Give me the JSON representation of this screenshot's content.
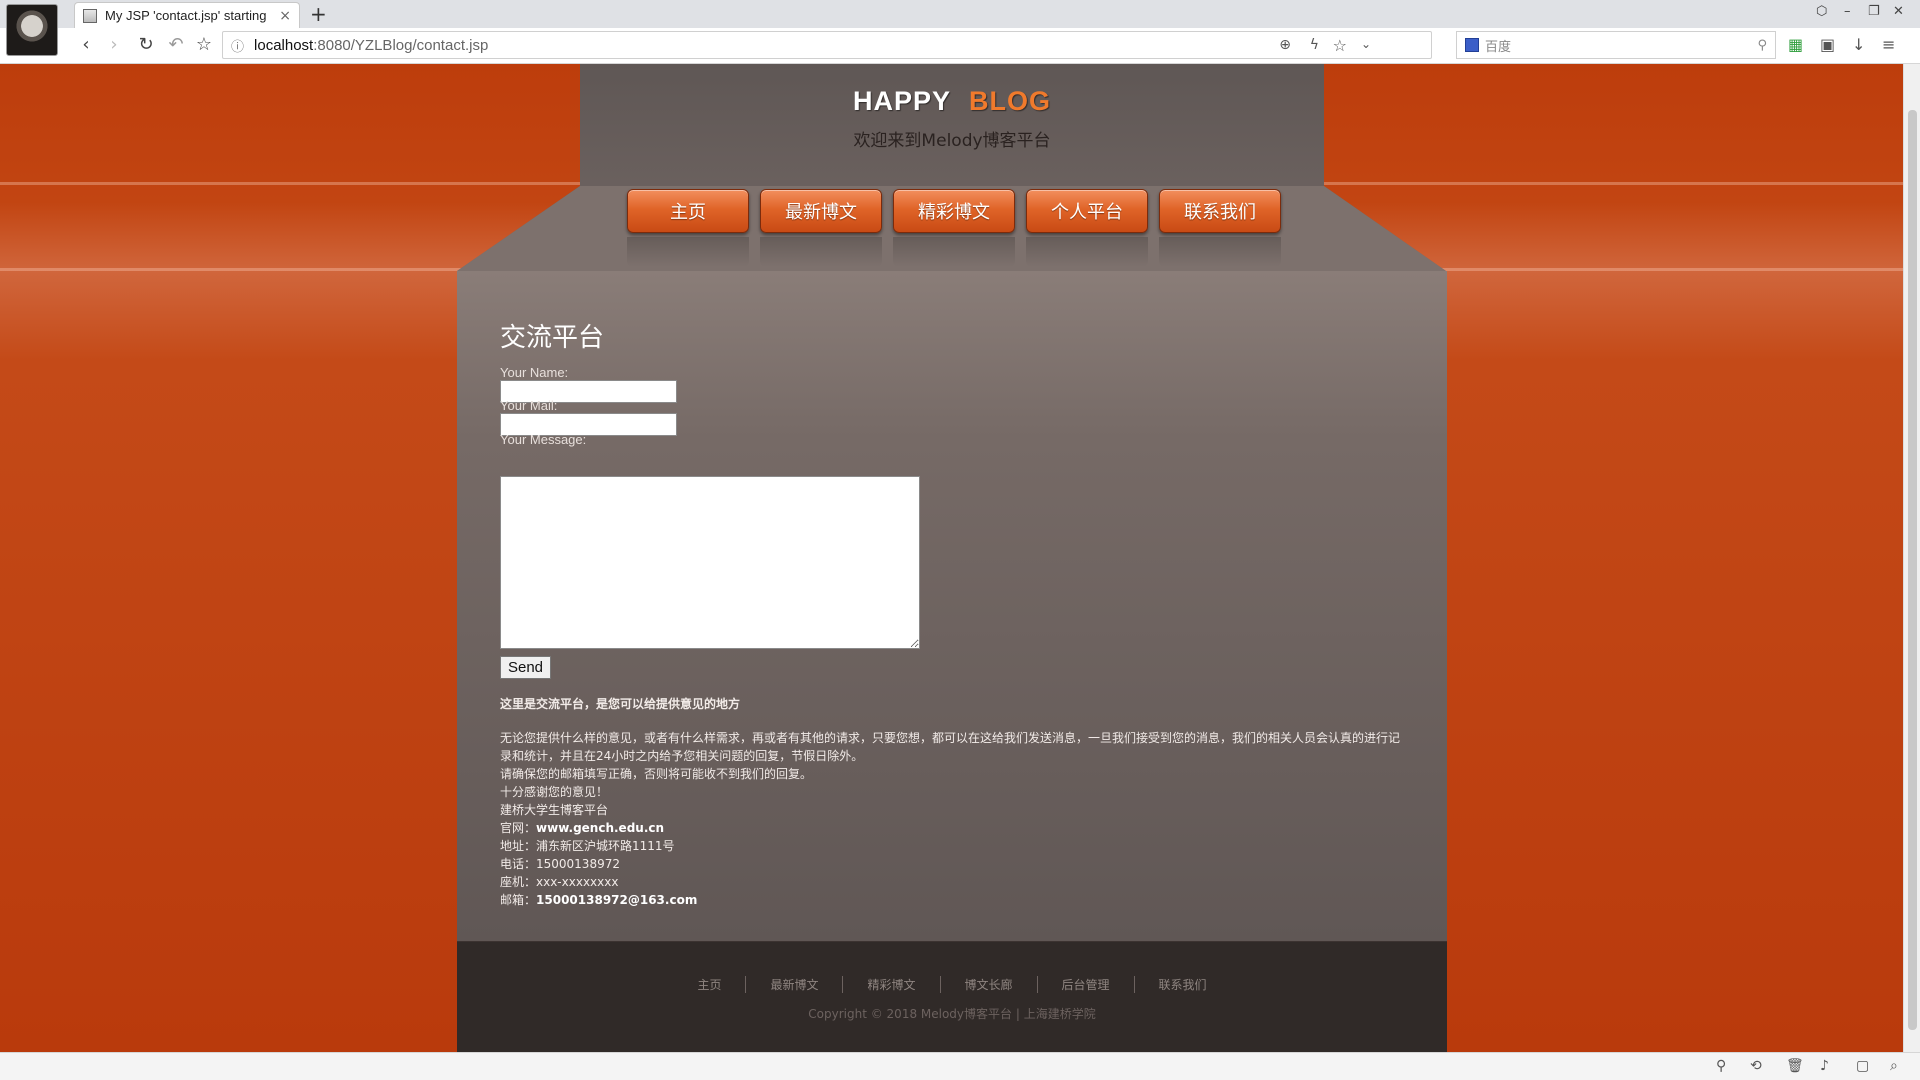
{
  "browser": {
    "tab_title": "My JSP 'contact.jsp' starting",
    "tab_close": "×",
    "new_tab": "+",
    "url_host": "localhost",
    "url_path": ":8080/YZLBlog/contact.jsp",
    "search_placeholder": "百度",
    "window_controls": [
      "–",
      "❐",
      "✕"
    ]
  },
  "site": {
    "logo_part1": "HAPPY",
    "logo_part2": "BLOG",
    "tagline": "欢迎来到Melody博客平台",
    "nav": [
      "主页",
      "最新博文",
      "精彩博文",
      "个人平台",
      "联系我们"
    ]
  },
  "contact": {
    "heading": "交流平台",
    "name_label": "Your Name:",
    "mail_label": "Your Mail:",
    "message_label": "Your Message:",
    "send_label": "Send",
    "info_title": "这里是交流平台，是您可以给提供意见的地方",
    "info_paragraph": "无论您提供什么样的意见，或者有什么样需求，再或者有其他的请求，只要您想，都可以在这给我们发送消息，一旦我们接受到您的消息，我们的相关人员会认真的进行记录和统计，并且在24小时之内给予您相关问题的回复，节假日除外。",
    "info_line2": "请确保您的邮箱填写正确，否则将可能收不到我们的回复。",
    "info_line3": "十分感谢您的意见！",
    "info_line4": "建桥大学生博客平台",
    "website_label": "官网：",
    "website_value": "www.gench.edu.cn",
    "address": "地址：浦东新区沪城环路1111号",
    "phone": "电话：15000138972",
    "landline": "座机：xxx-xxxxxxxx",
    "email_label": "邮箱：",
    "email_value": "15000138972@163.com"
  },
  "footer": {
    "links": [
      "主页",
      "最新博文",
      "精彩博文",
      "博文长廊",
      "后台管理",
      "联系我们"
    ],
    "copyright": "Copyright © 2018 Melody博客平台 | 上海建桥学院"
  }
}
